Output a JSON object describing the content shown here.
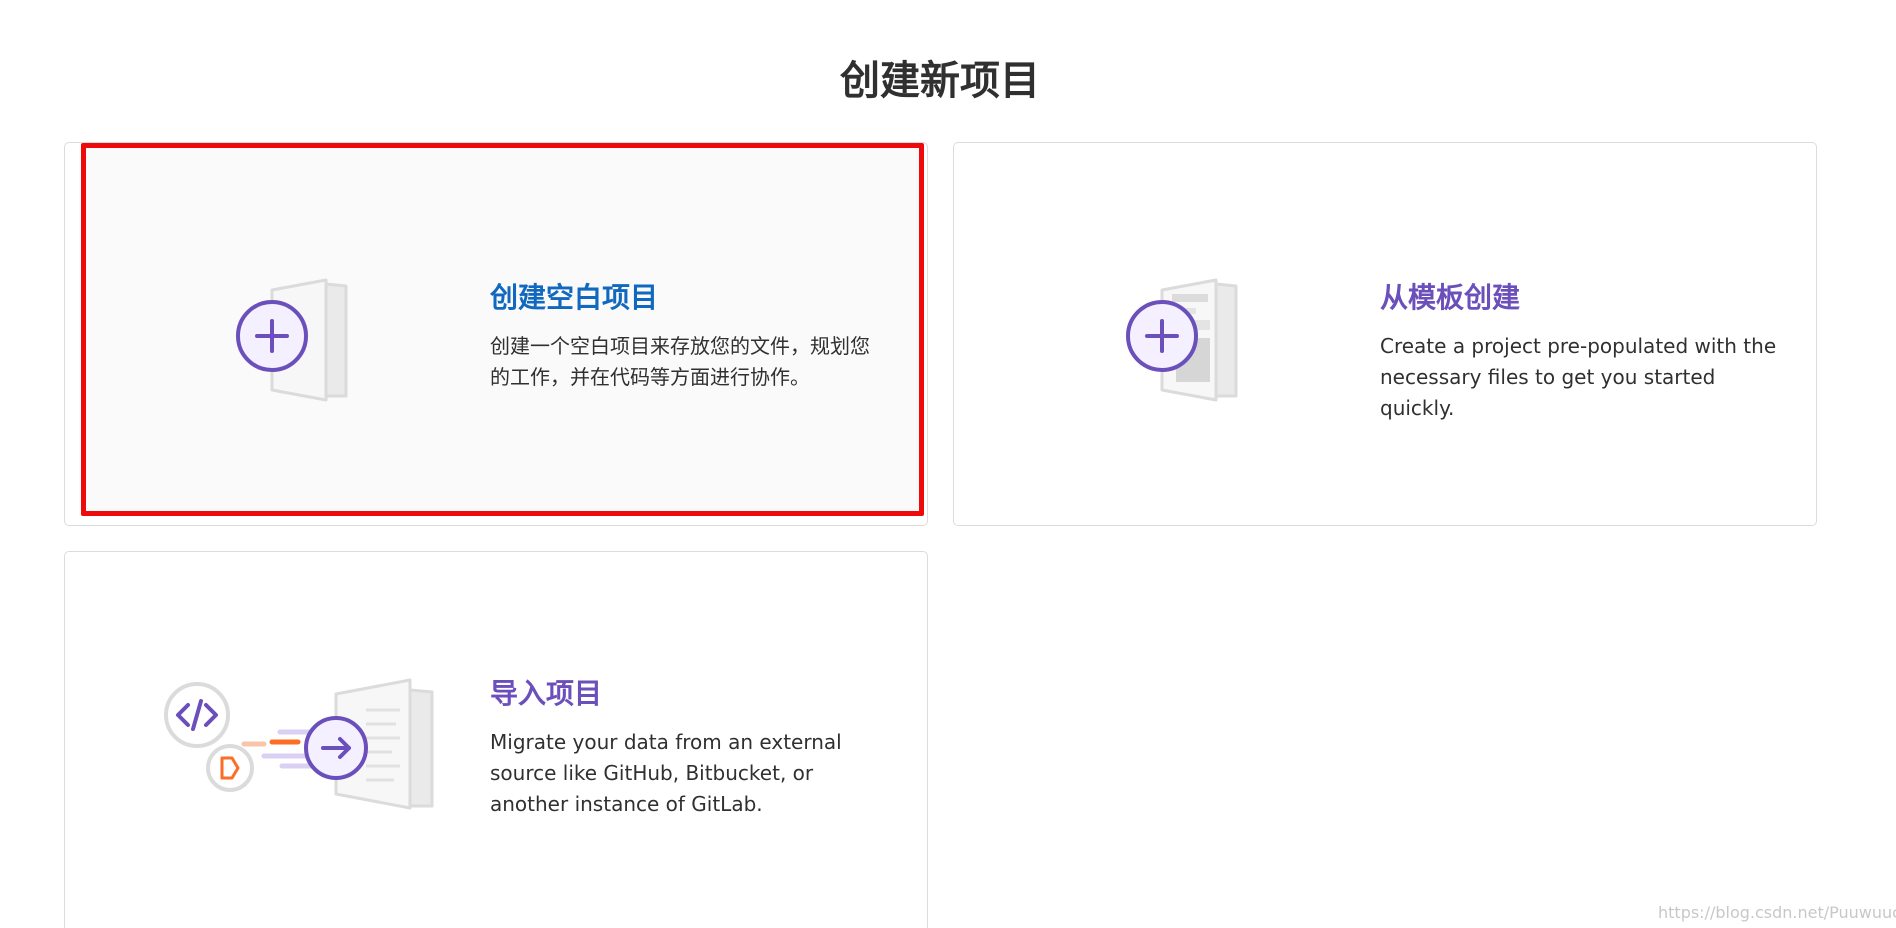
{
  "header": {
    "title": "创建新项目"
  },
  "cards": {
    "blank": {
      "title": "创建空白项目",
      "description": "创建一个空白项目来存放您的文件，规划您的工作，并在代码等方面进行协作。"
    },
    "template": {
      "title": "从模板创建",
      "description": "Create a project pre-populated with the necessary files to get you started quickly."
    },
    "import": {
      "title": "导入项目",
      "description": "Migrate your data from an external source like GitHub, Bitbucket, or another instance of GitLab."
    }
  },
  "watermark": "https://blog.csdn.net/Puuwuuchao",
  "colors": {
    "accent_blue": "#1068bf",
    "accent_purple": "#6b4fbb",
    "highlight_red": "#ee0a0a",
    "orange": "#fc6d26"
  }
}
